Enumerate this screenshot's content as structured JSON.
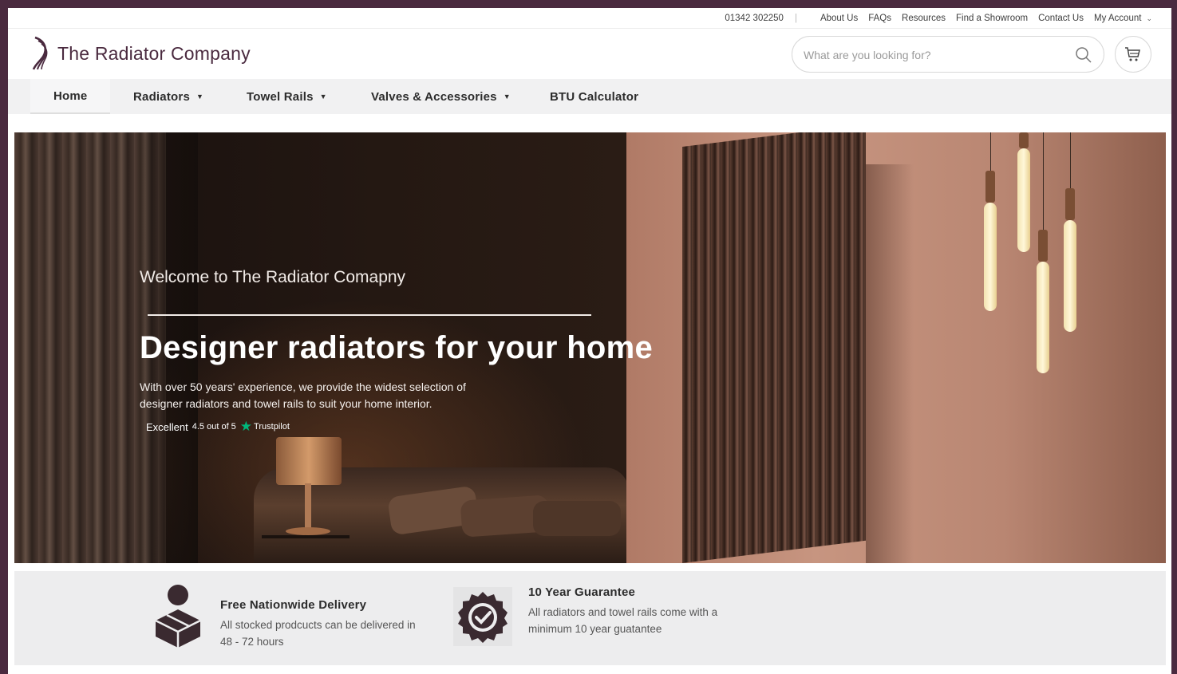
{
  "utility": {
    "phone": "01342 302250",
    "links": [
      "About Us",
      "FAQs",
      "Resources",
      "Find a Showroom",
      "Contact Us",
      "My Account"
    ]
  },
  "header": {
    "logo_text": "The Radiator Company",
    "search_placeholder": "What are you looking for?"
  },
  "nav": {
    "items": [
      {
        "label": "Home",
        "dropdown": false,
        "active": true
      },
      {
        "label": "Radiators",
        "dropdown": true
      },
      {
        "label": "Towel Rails",
        "dropdown": true
      },
      {
        "label": "Valves & Accessories",
        "dropdown": true
      },
      {
        "label": "BTU Calculator",
        "dropdown": false
      }
    ]
  },
  "hero": {
    "welcome": "Welcome to The Radiator Comapny",
    "headline": "Designer radiators for your home",
    "description": "With over 50 years' experience, we provide the widest selection of designer radiators and towel rails to suit your home interior.",
    "rating_word": "Excellent",
    "rating_score": "4.5 out of 5",
    "rating_source": "Trustpilot"
  },
  "benefits": [
    {
      "title": "Free Nationwide Delivery",
      "text": "All stocked prodcucts can be delivered in 48 - 72 hours",
      "icon": "delivery-box-icon"
    },
    {
      "title": "10 Year Guarantee",
      "text": "All radiators and towel rails come with a minimum 10 year guatantee",
      "icon": "guarantee-badge-icon"
    }
  ],
  "colors": {
    "brand": "#4a2a3f",
    "nav_bg": "#f1f1f2",
    "strip_bg": "#ededee",
    "trustpilot": "#00b67a"
  }
}
